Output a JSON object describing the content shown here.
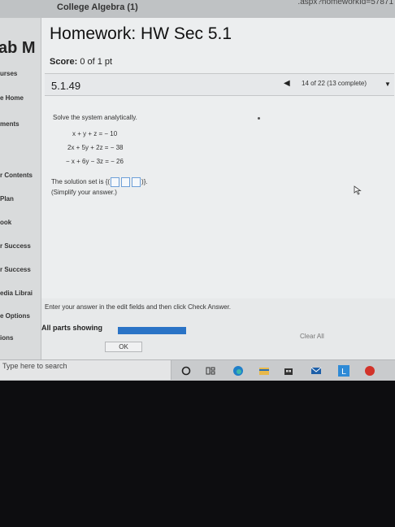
{
  "browser": {
    "tab_title": "College Algebra (1)",
    "url_fragment": ".aspx?homeworkId=57871"
  },
  "sidebar": {
    "brand": "ab M",
    "items": [
      {
        "label": "urses"
      },
      {
        "label": "e Home"
      },
      {
        "label": "ments"
      },
      {
        "label": "r Contents"
      },
      {
        "label": "Plan"
      },
      {
        "label": "ook"
      },
      {
        "label": "r Success"
      },
      {
        "label": "r Success"
      },
      {
        "label": "edia Librai"
      },
      {
        "label": "e Options"
      },
      {
        "label": "ions"
      }
    ]
  },
  "homework": {
    "title": "Homework: HW Sec 5.1",
    "score_label": "Score:",
    "score_value": "0 of 1 pt",
    "question_number": "5.1.49",
    "progress_text": "14 of 22 (13 complete)",
    "prompt": "Solve the system analytically.",
    "equations": [
      "x + y + z = − 10",
      "2x + 5y + 2z = − 38",
      "− x + 6y − 3z = − 26"
    ],
    "solution_prefix": "The solution set is {(",
    "solution_suffix": ")}.",
    "hint": "(Simplify your answer.)",
    "instruction": "Enter your answer in the edit fields and then click Check Answer.",
    "parts_label": "All parts showing",
    "parts_progress": 1.0,
    "clear_all_label": "Clear All",
    "ok_label": "OK"
  },
  "taskbar": {
    "search_placeholder": "Type here to search",
    "icons": [
      "cortana-icon",
      "task-view-icon",
      "edge-icon",
      "file-explorer-icon",
      "store-icon",
      "mail-icon",
      "app-l-icon",
      "app-red-icon"
    ]
  },
  "colors": {
    "accent": "#2a73c6",
    "box_border": "#6ea0d8"
  }
}
